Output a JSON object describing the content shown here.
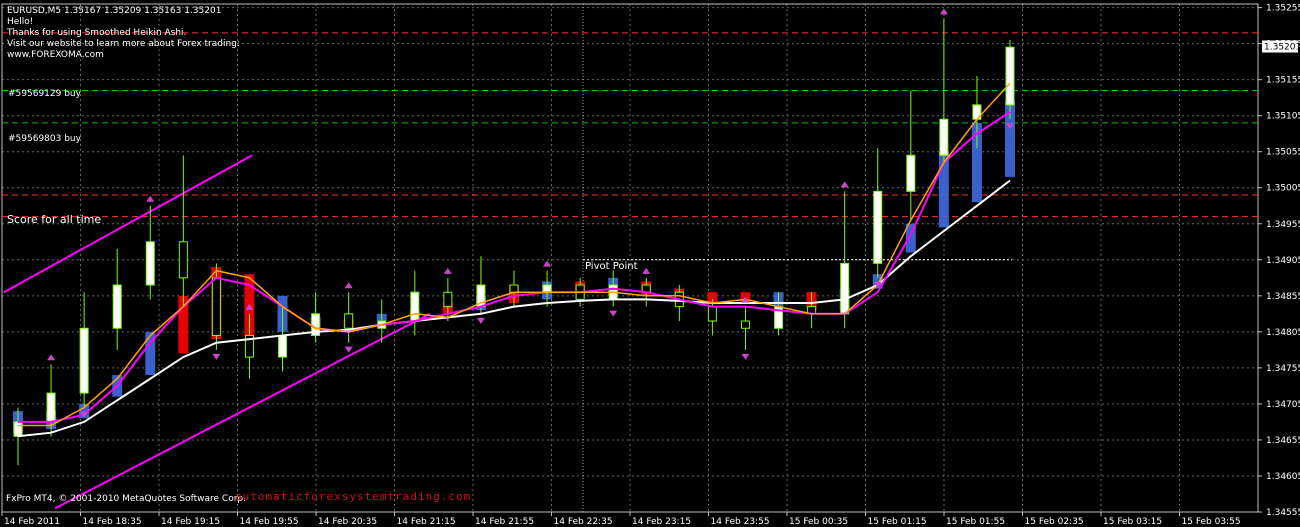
{
  "header": {
    "symbol_line": "EURUSD,M5  1.35167 1.35209 1.35163 1.35201",
    "lines": [
      "Hello!",
      "Thanks for using Smoothed Heikin Ashi.",
      "Visit our website to learn more about Forex trading:",
      "www.FOREXOMA.com"
    ]
  },
  "labels": {
    "order1": "#59569129 buy",
    "order2": "#59569803 buy",
    "score": "Score for all time",
    "pivot": "Pivot Point",
    "copyright": "FxPro MT4, © 2001-2010 MetaQuotes Software Corp.",
    "watermark": "automaticforexsystemtrading.com"
  },
  "colors": {
    "background": "#000000",
    "grid": "#5a6e5a",
    "bull_candle": "#7cfc00",
    "bear_candle": "#ffffff",
    "ha_up": "#4169e1",
    "ha_down": "#ff0000",
    "ma_fast": "#ffa500",
    "ma_mid": "#ff00ff",
    "ma_slow": "#ffffff",
    "channel": "#ff00ff",
    "order_line": "#00c000",
    "resistance_line": "#ff3030",
    "fractal": "#cc44cc",
    "price_tag": "#ffffff"
  },
  "chart_data": {
    "type": "candlestick",
    "symbol": "EURUSD",
    "timeframe": "M5",
    "ylim": [
      1.34555,
      1.3526
    ],
    "y_ticks": [
      "1.35255",
      "1.35205",
      "1.35155",
      "1.35105",
      "1.35055",
      "1.35005",
      "1.34955",
      "1.34905",
      "1.34855",
      "1.34805",
      "1.34755",
      "1.34705",
      "1.34655",
      "1.34605",
      "1.34555"
    ],
    "current_price": "1.35201",
    "x_ticks": [
      "14 Feb 2011",
      "14 Feb 18:35",
      "14 Feb 19:15",
      "14 Feb 19:55",
      "14 Feb 20:35",
      "14 Feb 21:15",
      "14 Feb 21:55",
      "14 Feb 22:35",
      "14 Feb 23:15",
      "14 Feb 23:55",
      "15 Feb 00:35",
      "15 Feb 01:15",
      "15 Feb 01:55",
      "15 Feb 02:35",
      "15 Feb 03:15",
      "15 Feb 03:55"
    ],
    "horizontal_levels": [
      {
        "price": 1.3522,
        "kind": "resistance"
      },
      {
        "price": 1.3514,
        "kind": "order"
      },
      {
        "price": 1.35095,
        "kind": "order"
      },
      {
        "price": 1.34995,
        "kind": "resistance"
      },
      {
        "price": 1.34965,
        "kind": "resistance"
      },
      {
        "price": 1.34905,
        "kind": "pivot"
      }
    ],
    "ma_fast": [
      1.34675,
      1.34675,
      1.347,
      1.3474,
      1.348,
      1.3484,
      1.3489,
      1.3488,
      1.3484,
      1.3481,
      1.34805,
      1.34815,
      1.3483,
      1.34825,
      1.34845,
      1.3486,
      1.3486,
      1.3486,
      1.3486,
      1.34855,
      1.34855,
      1.34845,
      1.3485,
      1.3484,
      1.3483,
      1.3483,
      1.3487,
      1.3496,
      1.3504,
      1.351,
      1.3515
    ],
    "ma_mid": [
      1.3468,
      1.3468,
      1.3469,
      1.3473,
      1.3479,
      1.3484,
      1.3488,
      1.3487,
      1.3484,
      1.3481,
      1.34805,
      1.34815,
      1.3482,
      1.3483,
      1.3484,
      1.34855,
      1.3486,
      1.3486,
      1.34865,
      1.3486,
      1.3485,
      1.3484,
      1.3484,
      1.34835,
      1.3483,
      1.3483,
      1.3486,
      1.3494,
      1.3504,
      1.3508,
      1.3511
    ],
    "ma_slow": [
      1.3466,
      1.34665,
      1.3468,
      1.3471,
      1.3474,
      1.3477,
      1.3479,
      1.34795,
      1.348,
      1.34805,
      1.34808,
      1.34815,
      1.3482,
      1.34825,
      1.3483,
      1.3484,
      1.34845,
      1.34848,
      1.3485,
      1.3485,
      1.34848,
      1.34845,
      1.34845,
      1.34845,
      1.34845,
      1.3485,
      1.3487,
      1.3491,
      1.34945,
      1.3498,
      1.35015
    ],
    "candles": [
      [
        1.3466,
        1.3468,
        1.3462,
        1.347
      ],
      [
        1.3468,
        1.3472,
        1.3466,
        1.3476
      ],
      [
        1.3472,
        1.3481,
        1.347,
        1.3486
      ],
      [
        1.3481,
        1.3487,
        1.3478,
        1.3492
      ],
      [
        1.3487,
        1.3493,
        1.3485,
        1.3498
      ],
      [
        1.3493,
        1.3488,
        1.3484,
        1.3505
      ],
      [
        1.3488,
        1.348,
        1.3478,
        1.349
      ],
      [
        1.348,
        1.3477,
        1.3474,
        1.3483
      ],
      [
        1.3477,
        1.348,
        1.3475,
        1.3484
      ],
      [
        1.348,
        1.3483,
        1.3479,
        1.3486
      ],
      [
        1.3483,
        1.3481,
        1.3479,
        1.3486
      ],
      [
        1.3481,
        1.3482,
        1.3479,
        1.3485
      ],
      [
        1.3482,
        1.3486,
        1.348,
        1.3489
      ],
      [
        1.3486,
        1.3484,
        1.3482,
        1.3488
      ],
      [
        1.3484,
        1.3487,
        1.3483,
        1.3491
      ],
      [
        1.3487,
        1.3486,
        1.3484,
        1.3489
      ],
      [
        1.3486,
        1.3487,
        1.3484,
        1.3489
      ],
      [
        1.3487,
        1.3485,
        1.3484,
        1.3488
      ],
      [
        1.3485,
        1.3487,
        1.3484,
        1.3489
      ],
      [
        1.3487,
        1.3486,
        1.3484,
        1.3488
      ],
      [
        1.3486,
        1.3484,
        1.3482,
        1.3487
      ],
      [
        1.3484,
        1.3482,
        1.348,
        1.3485
      ],
      [
        1.3482,
        1.3481,
        1.3478,
        1.3484
      ],
      [
        1.3481,
        1.3484,
        1.348,
        1.3486
      ],
      [
        1.3484,
        1.3483,
        1.3481,
        1.3486
      ],
      [
        1.3483,
        1.349,
        1.3481,
        1.35
      ],
      [
        1.349,
        1.35,
        1.3488,
        1.3506
      ],
      [
        1.35,
        1.3505,
        1.3496,
        1.3514
      ],
      [
        1.3505,
        1.351,
        1.3504,
        1.3524
      ],
      [
        1.351,
        1.3512,
        1.3506,
        1.3516
      ],
      [
        1.3512,
        1.352,
        1.351,
        1.3521
      ]
    ]
  }
}
